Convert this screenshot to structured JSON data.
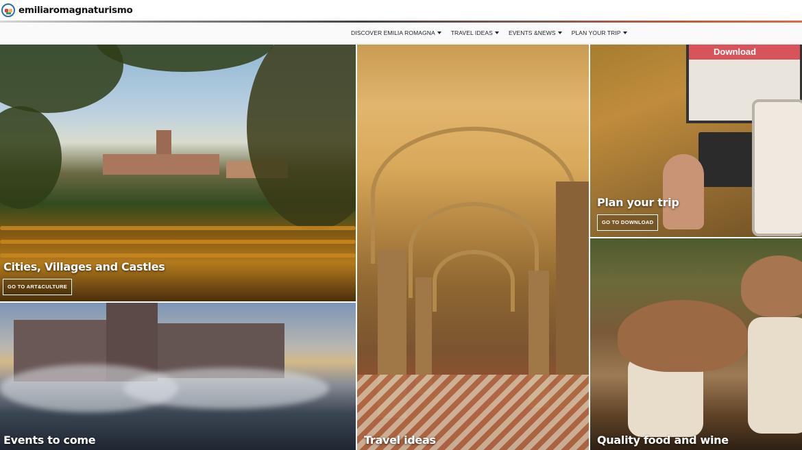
{
  "header": {
    "logo_text": "emiliaromagnaturismo",
    "logo_icon": "emilia-romagna-logo-icon"
  },
  "nav": {
    "items": [
      {
        "label": "DISCOVER EMILIA ROMAGNA"
      },
      {
        "label": "TRAVEL IDEAS"
      },
      {
        "label": "EVENTS &NEWS"
      },
      {
        "label": "PLAN YOUR TRIP"
      }
    ]
  },
  "tiles": {
    "cities": {
      "title": "Cities, Villages and Castles",
      "button": "GO TO ART&CULTURE"
    },
    "events": {
      "title": "Events to come"
    },
    "travel": {
      "title": "Travel ideas"
    },
    "plan": {
      "title": "Plan your trip",
      "button": "GO TO DOWNLOAD",
      "screen_heading": "Download"
    },
    "food": {
      "title": "Quality food and wine"
    }
  },
  "colors": {
    "header_line_start": "#d6d6d6",
    "header_line_end": "#e06a45",
    "download_banner": "#d9535a"
  }
}
